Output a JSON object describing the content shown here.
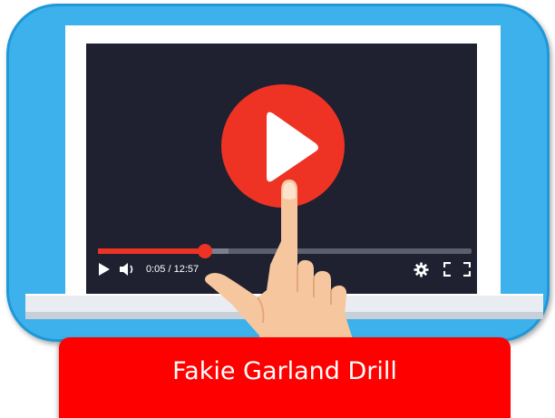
{
  "player": {
    "current_time": "0:05",
    "duration": "12:57",
    "time_display": "0:05 / 12:57",
    "progress_fraction": 0.287,
    "buffered_fraction": 0.35
  },
  "caption": {
    "title": "Fakie Garland Drill"
  },
  "icons": {
    "big_play": "play-icon",
    "small_play": "play-icon",
    "volume": "volume-icon",
    "settings": "gear-icon",
    "fullscreen": "fullscreen-icon",
    "hand": "pointing-hand-icon"
  },
  "colors": {
    "frame": "#3db1ec",
    "screen": "#1f2130",
    "accent_red": "#ee3325",
    "caption_bg": "#ff0000",
    "skin": "#f6c79f"
  }
}
